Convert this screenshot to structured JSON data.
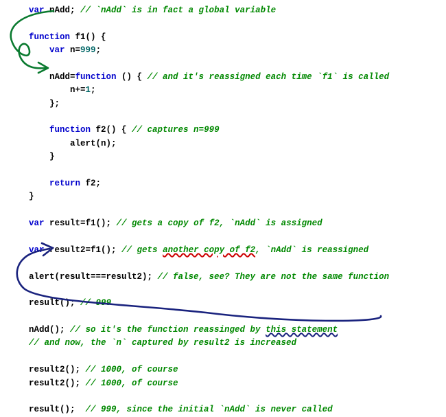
{
  "code": {
    "l1a": "var",
    "l1b": " nAdd; ",
    "l1c": "// `nAdd` is in fact a global variable",
    "l2a": "function",
    "l2b": " f1() {",
    "l3a": "    ",
    "l3b": "var",
    "l3c": " n=",
    "l3d": "999",
    "l3e": ";",
    "l4a": "    nAdd=",
    "l4b": "function",
    "l4c": " () { ",
    "l4d": "// and it's reassigned each time `f1` is called",
    "l5a": "        n+=",
    "l5b": "1",
    "l5c": ";",
    "l6a": "    };",
    "l7a": "    ",
    "l7b": "function",
    "l7c": " f2() { ",
    "l7d": "// captures n=999",
    "l8a": "        alert(n);",
    "l9a": "    }",
    "l10a": "    ",
    "l10b": "return",
    "l10c": " f2;",
    "l11a": "}",
    "l12a": "var",
    "l12b": " result=f1(); ",
    "l12c": "// gets a copy of f2, `nAdd` is assigned",
    "l13a": "var",
    "l13b": " result2=f1(); ",
    "l13c1": "// gets ",
    "l13c2": "another copy of f2",
    "l13c3": ", `nAdd` is reassigned",
    "l14a": "alert(result===result2); ",
    "l14b": "// false, see? They are not the same function",
    "l15a": "result(); ",
    "l15b": "// 999",
    "l16a": "nAdd(); ",
    "l16b1": "// so it's the function reassinged by ",
    "l16b2": "this statement",
    "l17a": "// and now, the `n` captured by result2 is increased",
    "l18a": "result2(); ",
    "l18b": "// 1000, of course",
    "l19a": "result2(); ",
    "l19b": "// 1000, of course",
    "l20a": "result();  ",
    "l20b": "// 999, since the initial `nAdd` is never called"
  },
  "annotations": {
    "green_arrow": "hand-drawn arrow from declaration of nAdd on line 1 looping down to the nAdd assignment inside f1",
    "blue_arrow": "hand-drawn arrow from 'this statement' annotation, swooping left past result(), up toward result2=f1() line",
    "red_wavy": "wavy red underline under 'another copy of f2'",
    "blue_wavy": "wavy blue underline under 'this statement'",
    "colors": {
      "green": "#0a7a2f",
      "blue": "#1a237e",
      "red": "#cc0000"
    }
  }
}
